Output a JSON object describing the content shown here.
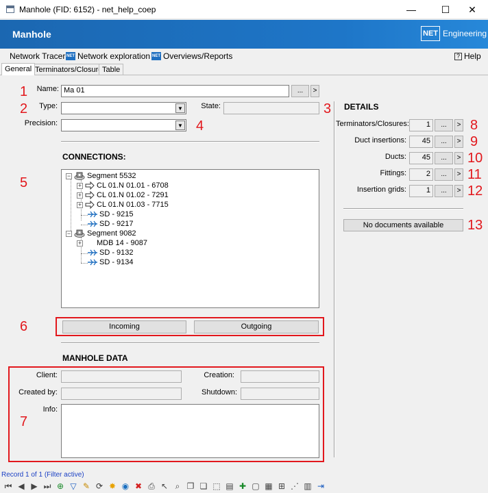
{
  "window": {
    "title": "Manhole (FID: 6152) - net_help_coep",
    "minimize": "—",
    "maximize": "☐",
    "close": "✕"
  },
  "header": {
    "title": "Manhole",
    "logo_mark": "NET",
    "logo_text": "Engineering"
  },
  "menu": {
    "network_tracer": "Network Tracer",
    "network_exploration": "Network exploration",
    "overviews_reports": "Overviews/Reports",
    "help": "Help",
    "net_icon": "NET",
    "help_icon": "?"
  },
  "tabs": [
    {
      "label": "General",
      "active": true
    },
    {
      "label": "Terminators/Closures",
      "active": false
    },
    {
      "label": "Table",
      "active": false
    }
  ],
  "general": {
    "name_label": "Name:",
    "name_value": "Ma 01",
    "type_label": "Type:",
    "type_value": "",
    "state_label": "State:",
    "state_value": "",
    "precision_label": "Precision:",
    "precision_value": "",
    "ellipsis": "...",
    "goto": ">"
  },
  "connections": {
    "title": "CONNECTIONS:",
    "tree": [
      {
        "label": "Segment 5532",
        "kind": "segment"
      },
      {
        "label": "CL 01.N 01.01 - 6708",
        "kind": "cable"
      },
      {
        "label": "CL 01.N 01.02 - 7291",
        "kind": "cable"
      },
      {
        "label": "CL 01.N 01.03 - 7715",
        "kind": "cable"
      },
      {
        "label": "SD - 9215",
        "kind": "duct"
      },
      {
        "label": "SD - 9217",
        "kind": "duct"
      },
      {
        "label": "Segment 9082",
        "kind": "segment"
      },
      {
        "label": "MDB 14 - 9087",
        "kind": "plain"
      },
      {
        "label": "SD - 9132",
        "kind": "duct"
      },
      {
        "label": "SD - 9134",
        "kind": "duct"
      }
    ],
    "incoming": "Incoming",
    "outgoing": "Outgoing"
  },
  "details": {
    "title": "DETAILS",
    "rows": [
      {
        "label": "Terminators/Closures:",
        "value": "1"
      },
      {
        "label": "Duct insertions:",
        "value": "45"
      },
      {
        "label": "Ducts:",
        "value": "45"
      },
      {
        "label": "Fittings:",
        "value": "2"
      },
      {
        "label": "Insertion grids:",
        "value": "1"
      }
    ],
    "documents": "No documents available"
  },
  "manhole_data": {
    "title": "MANHOLE DATA",
    "client_label": "Client:",
    "client_value": "",
    "creation_label": "Creation:",
    "creation_value": "",
    "created_by_label": "Created by:",
    "created_by_value": "",
    "shutdown_label": "Shutdown:",
    "shutdown_value": "",
    "info_label": "Info:",
    "info_value": ""
  },
  "callouts": [
    "1",
    "2",
    "3",
    "4",
    "5",
    "6",
    "7",
    "8",
    "9",
    "10",
    "11",
    "12",
    "13"
  ],
  "status": "Record 1 of 1 (Filter active)",
  "colors": {
    "accent_blue": "#1e76c8",
    "callout_red": "#e2171c",
    "status_blue": "#1a3fc4"
  },
  "toolbar": [
    {
      "name": "first-record-icon",
      "glyph": "⏮"
    },
    {
      "name": "previous-record-icon",
      "glyph": "◀"
    },
    {
      "name": "next-record-icon",
      "glyph": "▶"
    },
    {
      "name": "last-record-icon",
      "glyph": "⏭"
    },
    {
      "name": "add-filter-icon",
      "glyph": "⊕"
    },
    {
      "name": "filter-icon",
      "glyph": "▽"
    },
    {
      "name": "edit-pencil-icon",
      "glyph": "✎"
    },
    {
      "name": "refresh-icon",
      "glyph": "⟳"
    },
    {
      "name": "highlight-icon",
      "glyph": "✸"
    },
    {
      "name": "globe-icon",
      "glyph": "◉"
    },
    {
      "name": "delete-icon",
      "glyph": "✖"
    },
    {
      "name": "print-icon",
      "glyph": "⎙"
    },
    {
      "name": "select-pointer-icon",
      "glyph": "↖"
    },
    {
      "name": "zoom-icon",
      "glyph": "⌕"
    },
    {
      "name": "copy-icon",
      "glyph": "❐"
    },
    {
      "name": "duplicate-icon",
      "glyph": "❏"
    },
    {
      "name": "select-frame-icon",
      "glyph": "⬚"
    },
    {
      "name": "layers-icon",
      "glyph": "▤"
    },
    {
      "name": "new-object-icon",
      "glyph": "✚"
    },
    {
      "name": "document-icon",
      "glyph": "▢"
    },
    {
      "name": "report-icon",
      "glyph": "▦"
    },
    {
      "name": "add-document-icon",
      "glyph": "⊞"
    },
    {
      "name": "network-icon",
      "glyph": "⋰"
    },
    {
      "name": "table-icon",
      "glyph": "▥"
    },
    {
      "name": "exit-icon",
      "glyph": "⇥"
    }
  ]
}
